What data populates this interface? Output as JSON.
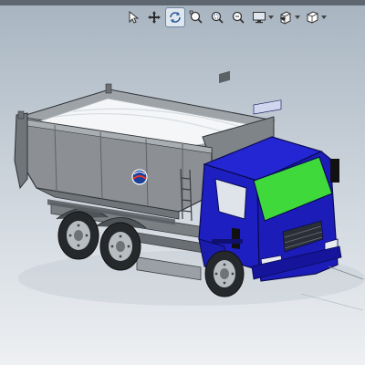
{
  "viewport": {
    "background_top": "#a7b4c0",
    "background_bottom": "#eef0f2"
  },
  "toolbar": {
    "items": [
      {
        "name": "select-arrow-icon",
        "active": false
      },
      {
        "name": "pan-icon",
        "active": false
      },
      {
        "name": "rotate-view-icon",
        "active": true
      },
      {
        "name": "zoom-to-fit-icon",
        "active": false
      },
      {
        "name": "zoom-to-area-icon",
        "active": false
      },
      {
        "name": "zoom-in-out-icon",
        "active": false
      },
      {
        "name": "display-style-icon",
        "active": false,
        "dropdown": true
      },
      {
        "name": "appearance-icon",
        "active": false,
        "dropdown": true
      },
      {
        "name": "view-orientation-icon",
        "active": false,
        "dropdown": true
      }
    ]
  },
  "model": {
    "description_colors": {
      "cab_color": "#1d1fc0",
      "windshield_color": "#3fd93b",
      "dump_body_color": "#8c9094",
      "load_color": "#f4f6f8",
      "tire_color": "#26292c"
    }
  }
}
